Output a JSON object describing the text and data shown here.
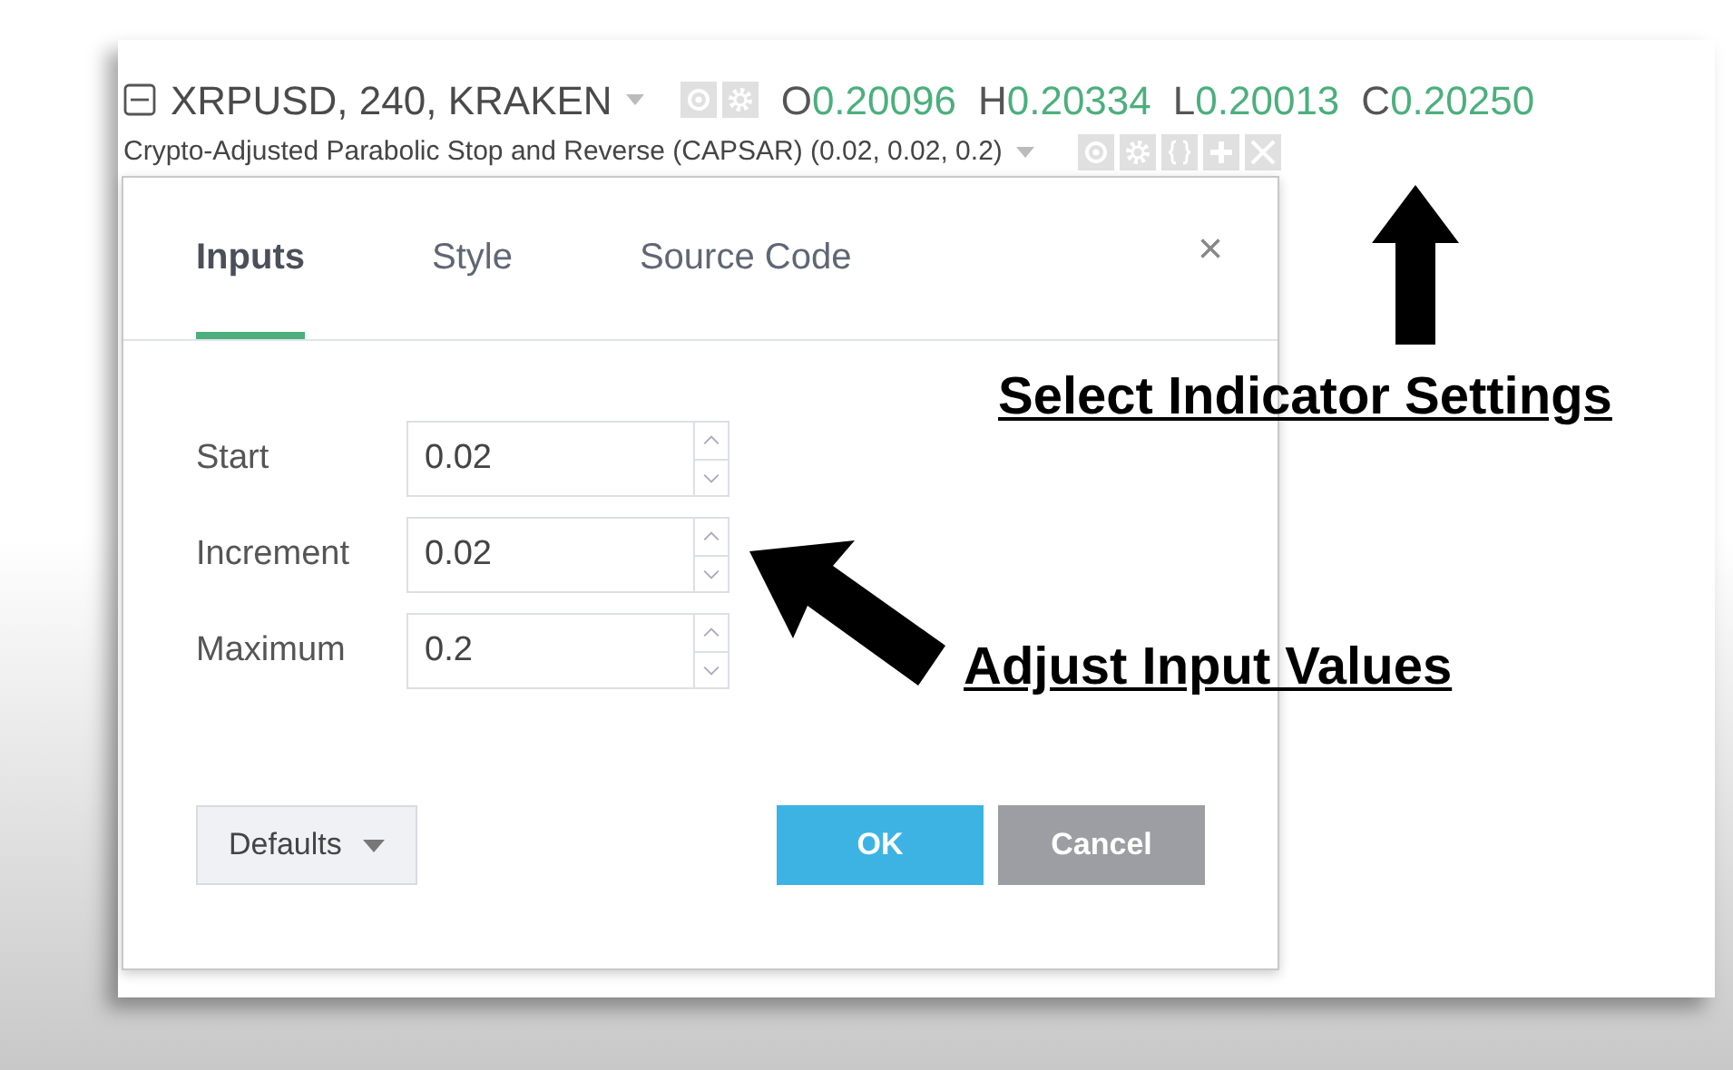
{
  "header": {
    "symbol": "XRPUSD, 240, KRAKEN",
    "ohlc": [
      {
        "label": "O",
        "value": "0.20096"
      },
      {
        "label": "H",
        "value": "0.20334"
      },
      {
        "label": "L",
        "value": "0.20013"
      },
      {
        "label": "C",
        "value": "0.20250"
      }
    ],
    "indicator": "Crypto-Adjusted Parabolic Stop and Reverse (CAPSAR) (0.02, 0.02, 0.2)"
  },
  "dialog": {
    "tabs": [
      {
        "label": "Inputs",
        "selected": true
      },
      {
        "label": "Style",
        "selected": false
      },
      {
        "label": "Source Code",
        "selected": false
      }
    ],
    "close": "×",
    "inputs": [
      {
        "label": "Start",
        "value": "0.02"
      },
      {
        "label": "Increment",
        "value": "0.02"
      },
      {
        "label": "Maximum",
        "value": "0.2"
      }
    ],
    "defaults_button": "Defaults",
    "ok_button": "OK",
    "cancel_button": "Cancel"
  },
  "annotations": [
    {
      "text": "Select Indicator Settings"
    },
    {
      "text": "Adjust Input Values"
    }
  ]
}
